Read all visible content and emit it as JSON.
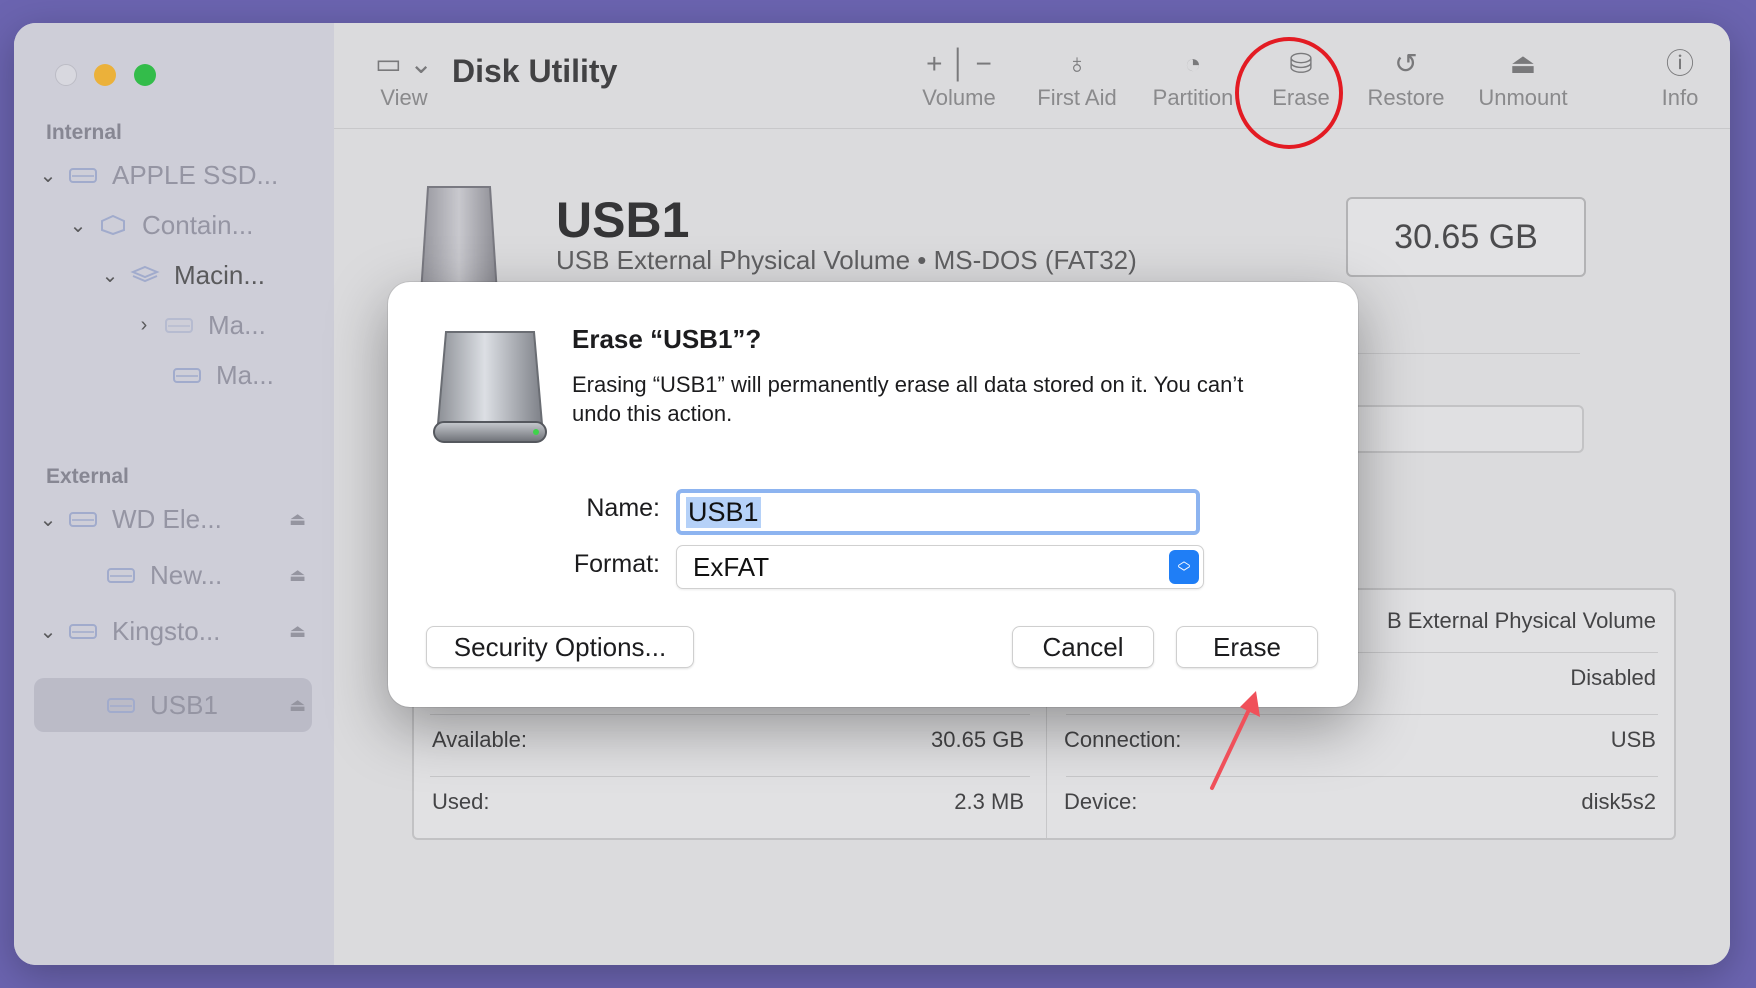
{
  "window": {
    "title": "Disk Utility"
  },
  "sidebar": {
    "sections": [
      {
        "label": "Internal"
      },
      {
        "label": "External"
      }
    ],
    "items": [
      {
        "label": "APPLE SSD...",
        "chevron": "⌄",
        "icon": "drive-icon"
      },
      {
        "label": "Contain...",
        "chevron": "⌄",
        "icon": "container-icon"
      },
      {
        "label": "Macin...",
        "chevron": "⌄",
        "icon": "volume-stack-icon"
      },
      {
        "label": "Ma...",
        "chevron": "›",
        "icon": "drive-icon"
      },
      {
        "label": "Ma...",
        "chevron": "",
        "icon": "drive-icon"
      },
      {
        "label": "WD Ele...",
        "chevron": "⌄",
        "icon": "drive-icon",
        "eject": "⏏"
      },
      {
        "label": "New...",
        "chevron": "",
        "icon": "drive-icon",
        "eject": "⏏"
      },
      {
        "label": "Kingsto...",
        "chevron": "⌄",
        "icon": "drive-icon",
        "eject": "⏏"
      },
      {
        "label": "USB1",
        "chevron": "",
        "icon": "drive-icon",
        "eject": "⏏",
        "selected": true
      }
    ]
  },
  "toolbar": {
    "view_label": "View",
    "volume_label": "Volume",
    "first_aid_label": "First Aid",
    "partition_label": "Partition",
    "erase_label": "Erase",
    "restore_label": "Restore",
    "unmount_label": "Unmount",
    "info_label": "Info"
  },
  "volume": {
    "name": "USB1",
    "subtitle": "USB External Physical Volume • MS-DOS (FAT32)",
    "capacity": "30.65 GB"
  },
  "details": {
    "type_value_partial": "B External Physical Volume",
    "owners_value": "Disabled",
    "available_label": "Available:",
    "available_value": "30.65 GB",
    "used_label": "Used:",
    "used_value": "2.3 MB",
    "connection_label": "Connection:",
    "connection_value": "USB",
    "device_label": "Device:",
    "device_value": "disk5s2"
  },
  "dialog": {
    "title": "Erase “USB1”?",
    "message": "Erasing “USB1” will permanently erase all data stored on it. You can’t undo this action.",
    "name_label": "Name:",
    "name_value": "USB1",
    "format_label": "Format:",
    "format_value": "ExFAT",
    "security_button": "Security Options...",
    "cancel_button": "Cancel",
    "erase_button": "Erase"
  },
  "colors": {
    "accent": "#1f7ef6",
    "annotation_red": "#e31b23",
    "arrow": "#f0505a"
  }
}
